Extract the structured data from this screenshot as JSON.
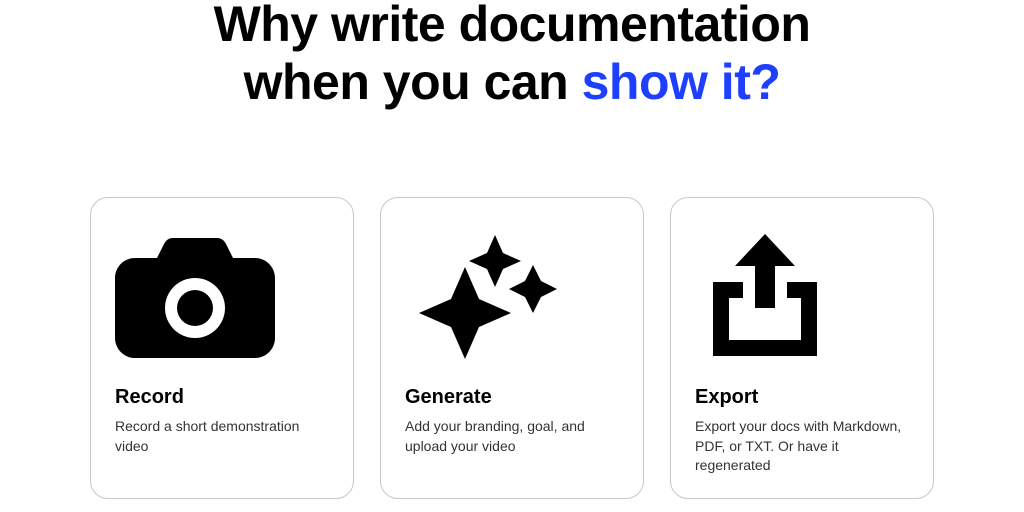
{
  "hero": {
    "line1": "Why write documentation",
    "line2_prefix": "when you can ",
    "line2_highlight": "show it?"
  },
  "cards": [
    {
      "title": "Record",
      "desc": "Record a short demonstration video"
    },
    {
      "title": "Generate",
      "desc": "Add your branding, goal, and upload your video"
    },
    {
      "title": "Export",
      "desc": "Export your docs with Markdown, PDF, or TXT. Or have it regenerated"
    }
  ]
}
